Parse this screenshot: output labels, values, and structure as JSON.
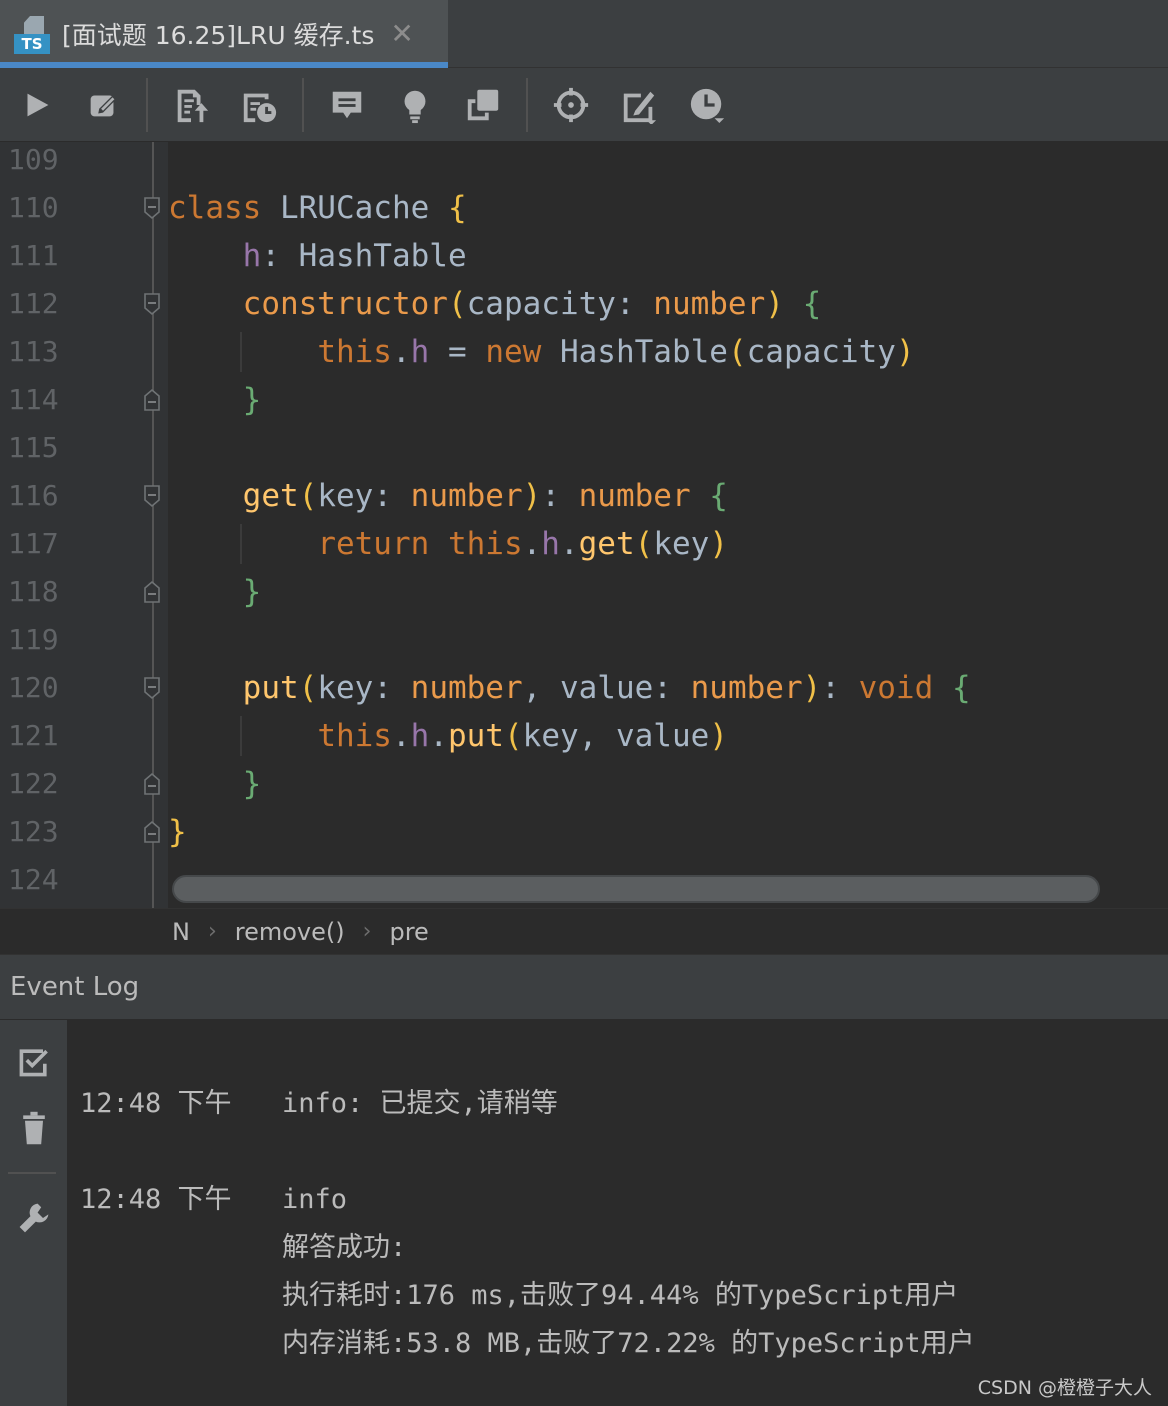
{
  "tab": {
    "badge": "TS",
    "title": "[面试题 16.25]LRU 缓存.ts",
    "close": "✕"
  },
  "toolbar": {
    "items": [
      "run-icon",
      "edit-icon",
      "submit-icon",
      "history-icon",
      "comment-icon",
      "hint-icon",
      "copy-icon",
      "locate-icon",
      "note-icon",
      "timer-icon"
    ]
  },
  "editor": {
    "line_numbers": [
      "109",
      "110",
      "111",
      "112",
      "113",
      "114",
      "115",
      "116",
      "117",
      "118",
      "119",
      "120",
      "121",
      "122",
      "123",
      "124"
    ],
    "lines": [
      [],
      [
        {
          "c": "k",
          "t": "class "
        },
        {
          "c": "t",
          "t": "LRUCache "
        },
        {
          "c": "y",
          "t": "{"
        }
      ],
      [
        {
          "c": "t",
          "t": "    "
        },
        {
          "c": "p",
          "t": "h"
        },
        {
          "c": "t",
          "t": ": HashTable"
        }
      ],
      [
        {
          "c": "t",
          "t": "    "
        },
        {
          "c": "o",
          "t": "constructor"
        },
        {
          "c": "y",
          "t": "("
        },
        {
          "c": "t",
          "t": "capacity: "
        },
        {
          "c": "o",
          "t": "number"
        },
        {
          "c": "y",
          "t": ")"
        },
        {
          "c": "t",
          "t": " "
        },
        {
          "c": "g",
          "t": "{"
        }
      ],
      [
        {
          "c": "t",
          "t": "        "
        },
        {
          "c": "k",
          "t": "this"
        },
        {
          "c": "t",
          "t": "."
        },
        {
          "c": "p",
          "t": "h"
        },
        {
          "c": "t",
          "t": " = "
        },
        {
          "c": "k",
          "t": "new "
        },
        {
          "c": "t",
          "t": "HashTable"
        },
        {
          "c": "y",
          "t": "("
        },
        {
          "c": "t",
          "t": "capacity"
        },
        {
          "c": "y",
          "t": ")"
        }
      ],
      [
        {
          "c": "t",
          "t": "    "
        },
        {
          "c": "g",
          "t": "}"
        }
      ],
      [],
      [
        {
          "c": "t",
          "t": "    "
        },
        {
          "c": "f",
          "t": "get"
        },
        {
          "c": "y",
          "t": "("
        },
        {
          "c": "t",
          "t": "key: "
        },
        {
          "c": "o",
          "t": "number"
        },
        {
          "c": "y",
          "t": ")"
        },
        {
          "c": "t",
          "t": ": "
        },
        {
          "c": "o",
          "t": "number"
        },
        {
          "c": "t",
          "t": " "
        },
        {
          "c": "g",
          "t": "{"
        }
      ],
      [
        {
          "c": "t",
          "t": "        "
        },
        {
          "c": "k",
          "t": "return "
        },
        {
          "c": "k",
          "t": "this"
        },
        {
          "c": "t",
          "t": "."
        },
        {
          "c": "p",
          "t": "h"
        },
        {
          "c": "t",
          "t": "."
        },
        {
          "c": "f",
          "t": "get"
        },
        {
          "c": "y",
          "t": "("
        },
        {
          "c": "t",
          "t": "key"
        },
        {
          "c": "y",
          "t": ")"
        }
      ],
      [
        {
          "c": "t",
          "t": "    "
        },
        {
          "c": "g",
          "t": "}"
        }
      ],
      [],
      [
        {
          "c": "t",
          "t": "    "
        },
        {
          "c": "f",
          "t": "put"
        },
        {
          "c": "y",
          "t": "("
        },
        {
          "c": "t",
          "t": "key: "
        },
        {
          "c": "o",
          "t": "number"
        },
        {
          "c": "t",
          "t": ", value: "
        },
        {
          "c": "o",
          "t": "number"
        },
        {
          "c": "y",
          "t": ")"
        },
        {
          "c": "t",
          "t": ": "
        },
        {
          "c": "k",
          "t": "void"
        },
        {
          "c": "t",
          "t": " "
        },
        {
          "c": "g",
          "t": "{"
        }
      ],
      [
        {
          "c": "t",
          "t": "        "
        },
        {
          "c": "k",
          "t": "this"
        },
        {
          "c": "t",
          "t": "."
        },
        {
          "c": "p",
          "t": "h"
        },
        {
          "c": "t",
          "t": "."
        },
        {
          "c": "f",
          "t": "put"
        },
        {
          "c": "y",
          "t": "("
        },
        {
          "c": "t",
          "t": "key, value"
        },
        {
          "c": "y",
          "t": ")"
        }
      ],
      [
        {
          "c": "t",
          "t": "    "
        },
        {
          "c": "g",
          "t": "}"
        }
      ],
      [
        {
          "c": "y",
          "t": "}"
        }
      ],
      []
    ]
  },
  "breadcrumb": {
    "items": [
      "N",
      "remove()",
      "pre"
    ],
    "separator": "›"
  },
  "event_log": {
    "title": "Event Log",
    "entries": [
      {
        "time": "12:48 下午",
        "lines": [
          "info: 已提交,请稍等"
        ]
      },
      {
        "time": "12:48 下午",
        "lines": [
          "info",
          "解答成功:",
          "执行耗时:176 ms,击败了94.44% 的TypeScript用户",
          "内存消耗:53.8 MB,击败了72.22% 的TypeScript用户"
        ]
      }
    ]
  },
  "watermark": "CSDN @橙橙子大人"
}
